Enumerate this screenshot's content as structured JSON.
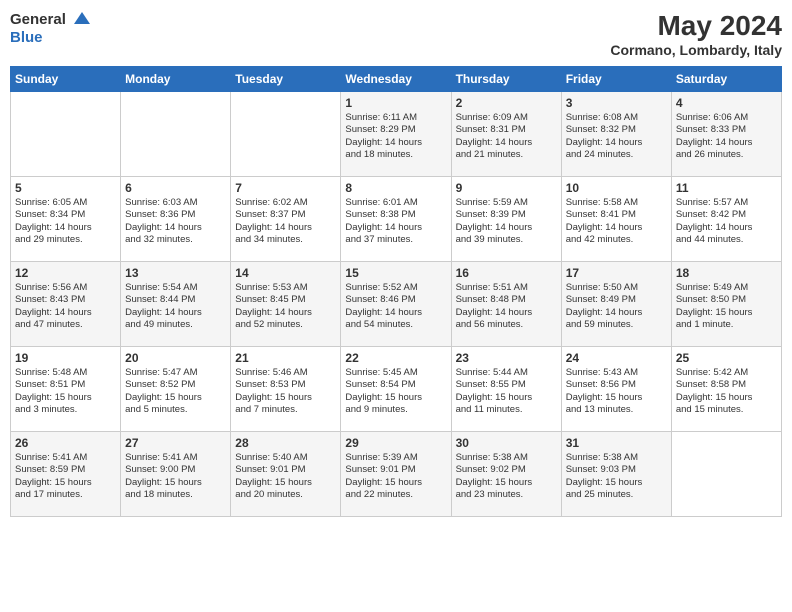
{
  "logo": {
    "general": "General",
    "blue": "Blue"
  },
  "title": {
    "month_year": "May 2024",
    "location": "Cormano, Lombardy, Italy"
  },
  "days_of_week": [
    "Sunday",
    "Monday",
    "Tuesday",
    "Wednesday",
    "Thursday",
    "Friday",
    "Saturday"
  ],
  "weeks": [
    [
      {
        "day": "",
        "info": ""
      },
      {
        "day": "",
        "info": ""
      },
      {
        "day": "",
        "info": ""
      },
      {
        "day": "1",
        "info": "Sunrise: 6:11 AM\nSunset: 8:29 PM\nDaylight: 14 hours\nand 18 minutes."
      },
      {
        "day": "2",
        "info": "Sunrise: 6:09 AM\nSunset: 8:31 PM\nDaylight: 14 hours\nand 21 minutes."
      },
      {
        "day": "3",
        "info": "Sunrise: 6:08 AM\nSunset: 8:32 PM\nDaylight: 14 hours\nand 24 minutes."
      },
      {
        "day": "4",
        "info": "Sunrise: 6:06 AM\nSunset: 8:33 PM\nDaylight: 14 hours\nand 26 minutes."
      }
    ],
    [
      {
        "day": "5",
        "info": "Sunrise: 6:05 AM\nSunset: 8:34 PM\nDaylight: 14 hours\nand 29 minutes."
      },
      {
        "day": "6",
        "info": "Sunrise: 6:03 AM\nSunset: 8:36 PM\nDaylight: 14 hours\nand 32 minutes."
      },
      {
        "day": "7",
        "info": "Sunrise: 6:02 AM\nSunset: 8:37 PM\nDaylight: 14 hours\nand 34 minutes."
      },
      {
        "day": "8",
        "info": "Sunrise: 6:01 AM\nSunset: 8:38 PM\nDaylight: 14 hours\nand 37 minutes."
      },
      {
        "day": "9",
        "info": "Sunrise: 5:59 AM\nSunset: 8:39 PM\nDaylight: 14 hours\nand 39 minutes."
      },
      {
        "day": "10",
        "info": "Sunrise: 5:58 AM\nSunset: 8:41 PM\nDaylight: 14 hours\nand 42 minutes."
      },
      {
        "day": "11",
        "info": "Sunrise: 5:57 AM\nSunset: 8:42 PM\nDaylight: 14 hours\nand 44 minutes."
      }
    ],
    [
      {
        "day": "12",
        "info": "Sunrise: 5:56 AM\nSunset: 8:43 PM\nDaylight: 14 hours\nand 47 minutes."
      },
      {
        "day": "13",
        "info": "Sunrise: 5:54 AM\nSunset: 8:44 PM\nDaylight: 14 hours\nand 49 minutes."
      },
      {
        "day": "14",
        "info": "Sunrise: 5:53 AM\nSunset: 8:45 PM\nDaylight: 14 hours\nand 52 minutes."
      },
      {
        "day": "15",
        "info": "Sunrise: 5:52 AM\nSunset: 8:46 PM\nDaylight: 14 hours\nand 54 minutes."
      },
      {
        "day": "16",
        "info": "Sunrise: 5:51 AM\nSunset: 8:48 PM\nDaylight: 14 hours\nand 56 minutes."
      },
      {
        "day": "17",
        "info": "Sunrise: 5:50 AM\nSunset: 8:49 PM\nDaylight: 14 hours\nand 59 minutes."
      },
      {
        "day": "18",
        "info": "Sunrise: 5:49 AM\nSunset: 8:50 PM\nDaylight: 15 hours\nand 1 minute."
      }
    ],
    [
      {
        "day": "19",
        "info": "Sunrise: 5:48 AM\nSunset: 8:51 PM\nDaylight: 15 hours\nand 3 minutes."
      },
      {
        "day": "20",
        "info": "Sunrise: 5:47 AM\nSunset: 8:52 PM\nDaylight: 15 hours\nand 5 minutes."
      },
      {
        "day": "21",
        "info": "Sunrise: 5:46 AM\nSunset: 8:53 PM\nDaylight: 15 hours\nand 7 minutes."
      },
      {
        "day": "22",
        "info": "Sunrise: 5:45 AM\nSunset: 8:54 PM\nDaylight: 15 hours\nand 9 minutes."
      },
      {
        "day": "23",
        "info": "Sunrise: 5:44 AM\nSunset: 8:55 PM\nDaylight: 15 hours\nand 11 minutes."
      },
      {
        "day": "24",
        "info": "Sunrise: 5:43 AM\nSunset: 8:56 PM\nDaylight: 15 hours\nand 13 minutes."
      },
      {
        "day": "25",
        "info": "Sunrise: 5:42 AM\nSunset: 8:58 PM\nDaylight: 15 hours\nand 15 minutes."
      }
    ],
    [
      {
        "day": "26",
        "info": "Sunrise: 5:41 AM\nSunset: 8:59 PM\nDaylight: 15 hours\nand 17 minutes."
      },
      {
        "day": "27",
        "info": "Sunrise: 5:41 AM\nSunset: 9:00 PM\nDaylight: 15 hours\nand 18 minutes."
      },
      {
        "day": "28",
        "info": "Sunrise: 5:40 AM\nSunset: 9:01 PM\nDaylight: 15 hours\nand 20 minutes."
      },
      {
        "day": "29",
        "info": "Sunrise: 5:39 AM\nSunset: 9:01 PM\nDaylight: 15 hours\nand 22 minutes."
      },
      {
        "day": "30",
        "info": "Sunrise: 5:38 AM\nSunset: 9:02 PM\nDaylight: 15 hours\nand 23 minutes."
      },
      {
        "day": "31",
        "info": "Sunrise: 5:38 AM\nSunset: 9:03 PM\nDaylight: 15 hours\nand 25 minutes."
      },
      {
        "day": "",
        "info": ""
      }
    ]
  ]
}
